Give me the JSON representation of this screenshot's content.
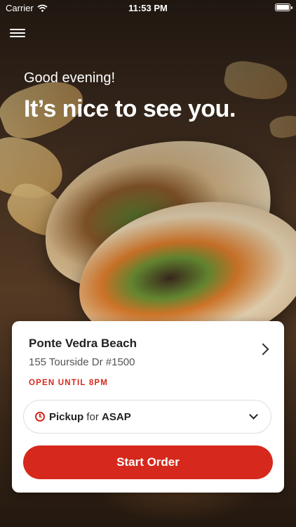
{
  "status_bar": {
    "carrier": "Carrier",
    "time": "11:53 PM",
    "battery_level": 1.0
  },
  "greeting": "Good evening!",
  "headline": "It’s nice to see you.",
  "location": {
    "name": "Ponte Vedra Beach",
    "address": "155 Tourside Dr #1500",
    "hours": "OPEN UNTIL 8PM"
  },
  "order_mode": {
    "mode": "Pickup",
    "connector": "for",
    "time": "ASAP"
  },
  "start_button": "Start Order",
  "colors": {
    "accent": "#d6281c",
    "text": "#222222",
    "muted": "#555555"
  },
  "icons": {
    "menu": "hamburger-icon",
    "wifi": "wifi-icon",
    "battery": "battery-icon",
    "location_chevron": "chevron-right-icon",
    "clock": "clock-icon",
    "dropdown": "chevron-down-icon"
  }
}
